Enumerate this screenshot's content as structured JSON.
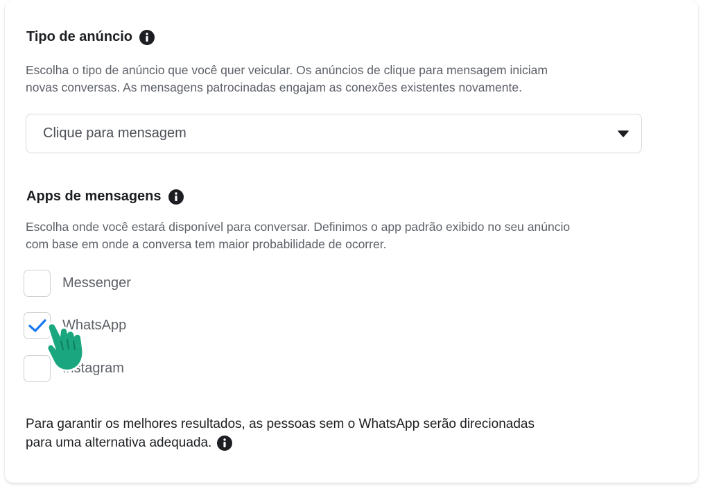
{
  "ad_type": {
    "title": "Tipo de anúncio",
    "description_line1": "Escolha o tipo de anúncio que você quer veicular. Os anúncios de clique para mensagem iniciam",
    "description_line2": "novas conversas. As mensagens patrocinadas engajam as conexões existentes novamente.",
    "selected_value": "Clique para mensagem"
  },
  "messaging_apps": {
    "title": "Apps de mensagens",
    "description_line1": "Escolha onde você estará disponível para conversar. Definimos o app padrão exibido no seu anúncio",
    "description_line2": "com base em onde a conversa tem maior probabilidade de ocorrer.",
    "options": [
      {
        "label": "Messenger",
        "checked": false
      },
      {
        "label": "WhatsApp",
        "checked": true
      },
      {
        "label": "Instagram",
        "checked": false
      }
    ]
  },
  "note": {
    "line1": "Para garantir os melhores resultados, as pessoas sem o WhatsApp serão direcionadas",
    "line2": "para uma alternativa adequada."
  },
  "colors": {
    "check": "#1877f2",
    "cursor_hand": "#1aa77f",
    "info_icon": "#1c1e21"
  },
  "icons": {
    "info": "info-icon",
    "dropdown": "caret-down-icon",
    "check": "checkmark-icon",
    "cursor": "pointer-hand-icon"
  }
}
